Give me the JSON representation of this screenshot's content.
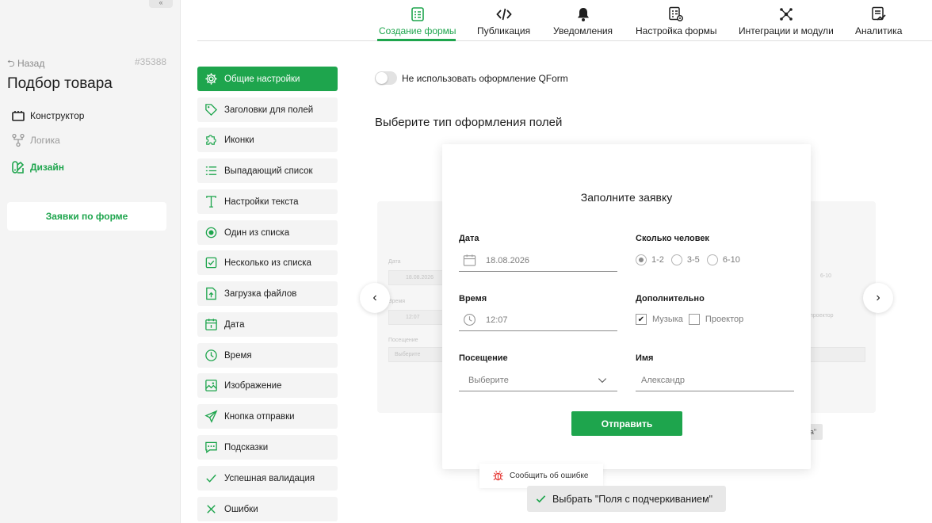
{
  "sidebar": {
    "back_label": "⮌ Назад",
    "form_id": "#35388",
    "form_title": "Подбор товара",
    "nav": [
      {
        "label": "Конструктор"
      },
      {
        "label": "Логика"
      },
      {
        "label": "Дизайн"
      }
    ],
    "requests_button": "Заявки по форме",
    "collapse_icon": "chevrons-left-icon"
  },
  "tabs": [
    {
      "label": "Создание формы",
      "icon": "form-list-icon",
      "active": true
    },
    {
      "label": "Публикация",
      "icon": "code-icon"
    },
    {
      "label": "Уведомления",
      "icon": "bell-icon"
    },
    {
      "label": "Настройка формы",
      "icon": "form-settings-icon"
    },
    {
      "label": "Интеграции и модули",
      "icon": "network-icon"
    },
    {
      "label": "Аналитика",
      "icon": "analytics-icon"
    }
  ],
  "settings_menu": [
    {
      "label": "Общие настройки",
      "icon": "gear-icon",
      "active": true
    },
    {
      "label": "Заголовки для полей",
      "icon": "tag-icon"
    },
    {
      "label": "Иконки",
      "icon": "puzzle-icon"
    },
    {
      "label": "Выпадающий список",
      "icon": "list-icon"
    },
    {
      "label": "Настройки текста",
      "icon": "text-icon"
    },
    {
      "label": "Один из списка",
      "icon": "radio-icon"
    },
    {
      "label": "Несколько из списка",
      "icon": "checkbox-icon"
    },
    {
      "label": "Загрузка файлов",
      "icon": "file-upload-icon"
    },
    {
      "label": "Дата",
      "icon": "calendar-icon"
    },
    {
      "label": "Время",
      "icon": "clock-icon"
    },
    {
      "label": "Изображение",
      "icon": "image-icon"
    },
    {
      "label": "Кнопка отправки",
      "icon": "send-icon"
    },
    {
      "label": "Подсказки",
      "icon": "chat-icon"
    },
    {
      "label": "Успешная валидация",
      "icon": "check-icon"
    },
    {
      "label": "Ошибки",
      "icon": "cross-icon"
    }
  ],
  "content": {
    "toggle_label": "Не использовать оформление QForm",
    "toggle_on": false,
    "section_title": "Выберите тип оформления полей"
  },
  "preview": {
    "title": "Заполните заявку",
    "date_label": "Дата",
    "date_value": "18.08.2026",
    "people_label": "Сколько человек",
    "people_options": [
      "1-2",
      "3-5",
      "6-10"
    ],
    "people_selected": "1-2",
    "time_label": "Время",
    "time_value": "12:07",
    "extra_label": "Дополнительно",
    "extra_options": [
      {
        "label": "Музыка",
        "checked": true
      },
      {
        "label": "Проектор",
        "checked": false
      }
    ],
    "visit_label": "Посещение",
    "visit_placeholder": "Выберите",
    "name_label": "Имя",
    "name_placeholder": "Александр",
    "submit_label": "Отправить"
  },
  "ghost_left": {
    "date_label": "Дата",
    "date_value": "18.08.2026",
    "time_label": "Время",
    "time_value": "12:07",
    "visit_label": "Посещение",
    "visit_value": "Выберите"
  },
  "ghost_right": {
    "radio_value": "6-10",
    "extra_value": "проектор",
    "button_tail": "а\""
  },
  "report_error_label": "Сообщить об ошибке",
  "select_label": "Выбрать \"Поля с подчеркиванием\"",
  "colors": {
    "accent": "#1ea54d",
    "sidebar_bg": "#f4f4f4"
  }
}
